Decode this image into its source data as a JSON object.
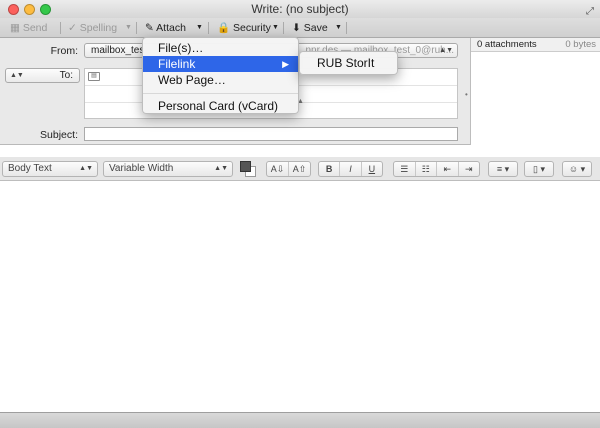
{
  "window": {
    "title": "Write: (no subject)"
  },
  "toolbar": {
    "send": "Send",
    "spelling": "Spelling",
    "attach": "Attach",
    "security": "Security",
    "save": "Save"
  },
  "header": {
    "from_label": "From:",
    "from_value": "mailbox_tes",
    "from_value_hidden": "...nnr.des — mailbox_test_0@ruh...",
    "to_label": "To:",
    "subject_label": "Subject:",
    "subject_value": ""
  },
  "attachments": {
    "count_label": "0 attachments",
    "size_label": "0 bytes"
  },
  "format_bar": {
    "paragraph_style": "Body Text",
    "font": "Variable Width",
    "bold": "B",
    "italic": "I",
    "underline": "U"
  },
  "attach_menu": {
    "items": [
      "File(s)…",
      "Filelink",
      "Web Page…",
      "Personal Card (vCard)"
    ],
    "highlighted": "Filelink"
  },
  "filelink_submenu": {
    "items": [
      "RUB StorIt"
    ]
  },
  "colors": {
    "menu_highlight": "#2e66e8",
    "close": "#fc605c",
    "minimize": "#fdbc40",
    "maximize": "#34c84a"
  }
}
